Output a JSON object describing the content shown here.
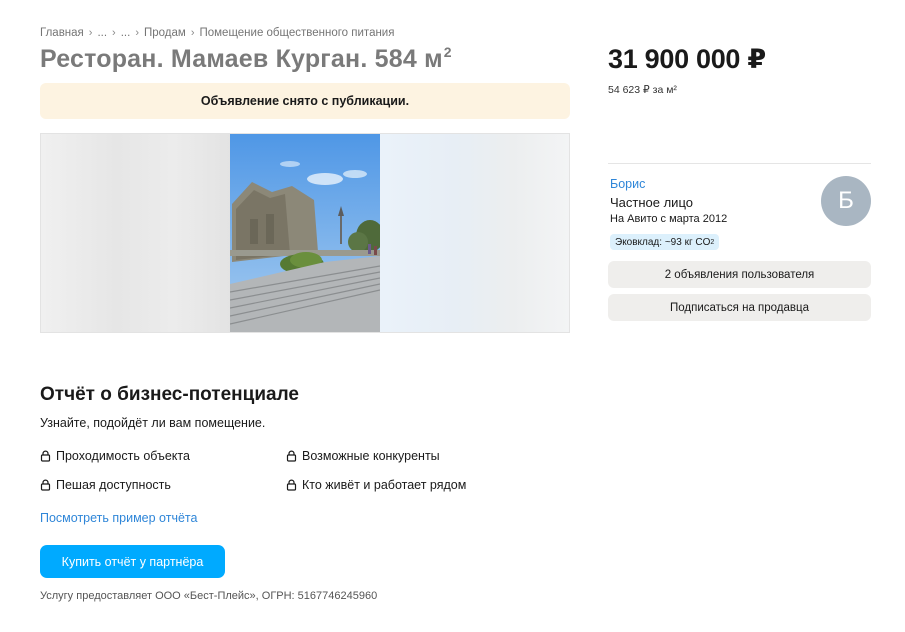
{
  "breadcrumb": {
    "items": [
      "Главная",
      "...",
      "...",
      "Продам",
      "Помещение общественного питания"
    ],
    "separator": "›"
  },
  "listing": {
    "title": "Ресторан. Мамаев Курган. 584 м",
    "title_sup": "2",
    "notice": "Объявление снято с публикации."
  },
  "price": {
    "value": "31 900 000 ₽",
    "per_meter": "54 623 ₽ за м²"
  },
  "seller": {
    "name": "Борис",
    "type": "Частное лицо",
    "since": "На Авито с марта 2012",
    "eco_prefix": "Эковклад: ~93 кг CO",
    "eco_sub": "2",
    "avatar_letter": "Б",
    "avatar_color": "#a9b6c2",
    "ads_button": "2 объявления пользователя",
    "subscribe_button": "Подписаться на продавца"
  },
  "report": {
    "title": "Отчёт о бизнес-потенциале",
    "subtitle": "Узнайте, подойдёт ли вам помещение.",
    "features": [
      "Проходимость объекта",
      "Возможные конкуренты",
      "Пешая доступность",
      "Кто живёт и работает рядом"
    ],
    "sample_link": "Посмотреть пример отчёта",
    "buy_button": "Купить отчёт у партнёра",
    "provider": "Услугу предоставляет ООО «Бест-Плейс», ОГРН: 5167746245960"
  },
  "colors": {
    "accent_blue": "#00aaff",
    "link_blue": "#2f86d8",
    "notice_bg": "#fdf3e1"
  }
}
